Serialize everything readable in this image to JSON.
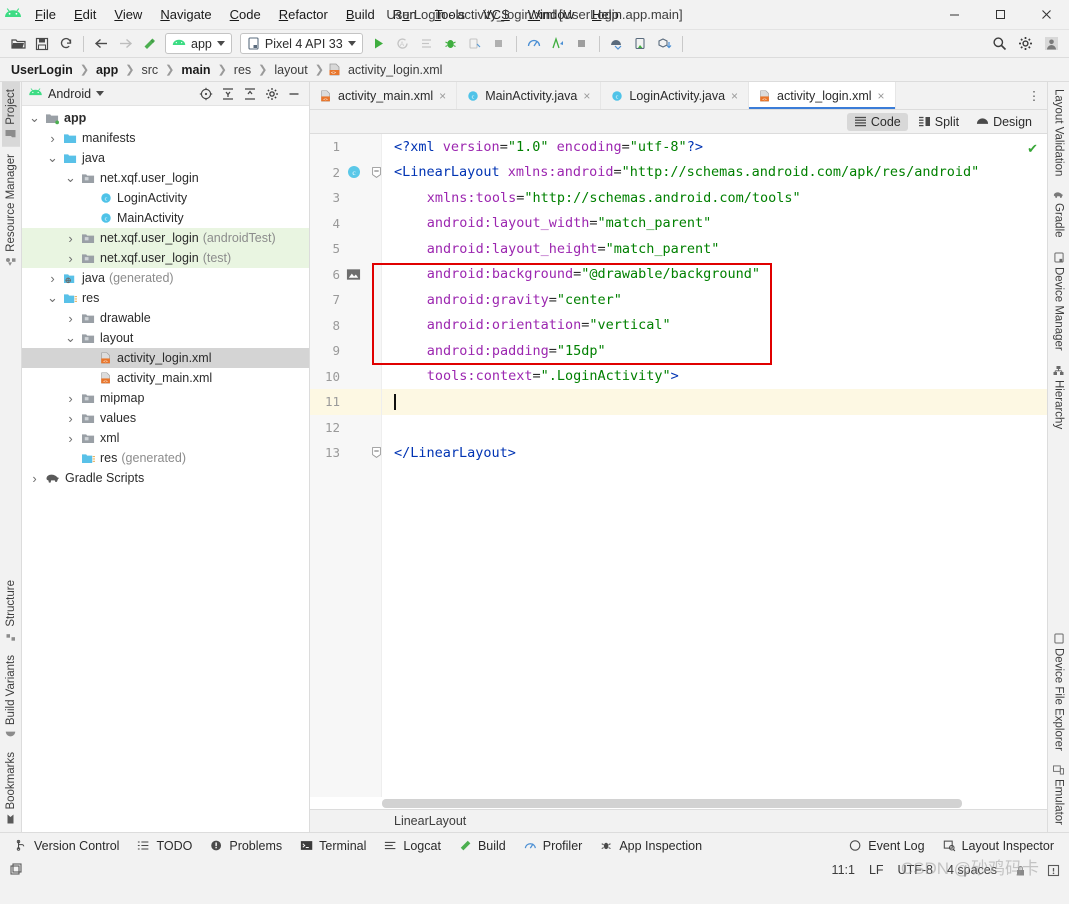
{
  "window": {
    "title": "UserLogin - activity_login.xml [UserLogin.app.main]",
    "minimize": "—",
    "maximize": "☐",
    "close": "✕"
  },
  "menu": [
    {
      "label": "File",
      "mnemonic": "F"
    },
    {
      "label": "Edit",
      "mnemonic": "E"
    },
    {
      "label": "View",
      "mnemonic": "V"
    },
    {
      "label": "Navigate",
      "mnemonic": "N"
    },
    {
      "label": "Code",
      "mnemonic": "C"
    },
    {
      "label": "Refactor",
      "mnemonic": "R"
    },
    {
      "label": "Build",
      "mnemonic": "B"
    },
    {
      "label": "Run",
      "mnemonic": "u"
    },
    {
      "label": "Tools",
      "mnemonic": "T"
    },
    {
      "label": "VCS",
      "mnemonic": "S"
    },
    {
      "label": "Window",
      "mnemonic": "W"
    },
    {
      "label": "Help",
      "mnemonic": "H"
    }
  ],
  "toolbar": {
    "icons_left": [
      "open-folder-icon",
      "save-icon",
      "sync-icon"
    ],
    "nav_icons": [
      "back-arrow-icon",
      "forward-arrow-icon",
      "build-hammer-icon"
    ],
    "module_combo": "app",
    "device_combo": "Pixel 4 API 33",
    "run_icons": [
      "run-icon",
      "apply-changes-icon",
      "apply-code-changes-icon",
      "debug-icon",
      "attach-debugger-icon",
      "stop-icon"
    ],
    "right_icons": [
      "profiler-icon",
      "profile-run-icon",
      "stop-square-icon",
      "device-mirror-icon",
      "device-explorer-icon",
      "sdk-download-icon"
    ],
    "far_right_icons": [
      "search-icon",
      "gear-icon",
      "avatar-icon"
    ]
  },
  "breadcrumb": [
    {
      "label": "UserLogin",
      "bold": true
    },
    {
      "label": "app",
      "bold": true
    },
    {
      "label": "src",
      "bold": false
    },
    {
      "label": "main",
      "bold": true
    },
    {
      "label": "res",
      "bold": false
    },
    {
      "label": "layout",
      "bold": false
    },
    {
      "label": "activity_login.xml",
      "bold": false,
      "icon": "xml-file-icon"
    }
  ],
  "left_strip": {
    "top": [
      {
        "label": "Project",
        "icon": "project-icon",
        "active": true
      },
      {
        "label": "Resource Manager",
        "icon": "resource-manager-icon",
        "active": false
      }
    ],
    "bottom": [
      {
        "label": "Structure",
        "icon": "structure-icon"
      },
      {
        "label": "Build Variants",
        "icon": "build-variants-icon"
      },
      {
        "label": "Bookmarks",
        "icon": "bookmarks-icon"
      }
    ]
  },
  "right_strip": {
    "top": [
      {
        "label": "Layout Validation",
        "icon": "layout-validation-icon"
      },
      {
        "label": "Gradle",
        "icon": "gradle-elephant-icon"
      },
      {
        "label": "Device Manager",
        "icon": "device-manager-icon"
      },
      {
        "label": "Hierarchy",
        "icon": "hierarchy-icon"
      }
    ],
    "bottom": [
      {
        "label": "Device File Explorer",
        "icon": "device-file-explorer-icon"
      },
      {
        "label": "Emulator",
        "icon": "emulator-icon"
      }
    ]
  },
  "project_panel": {
    "title": "Android",
    "header_icons": [
      "select-opened-file-icon",
      "expand-all-icon",
      "collapse-all-icon",
      "settings-gear-icon",
      "hide-icon"
    ],
    "tree": [
      {
        "label": "app",
        "indent": 0,
        "arrow": "down",
        "icon": "module-folder-icon",
        "bold": true,
        "state": "normal"
      },
      {
        "label": "manifests",
        "indent": 1,
        "arrow": "right",
        "icon": "folder-icon",
        "bold": false,
        "state": "normal"
      },
      {
        "label": "java",
        "indent": 1,
        "arrow": "down",
        "icon": "folder-icon",
        "bold": false,
        "state": "normal"
      },
      {
        "label": "net.xqf.user_login",
        "indent": 2,
        "arrow": "down",
        "icon": "package-icon",
        "bold": false,
        "state": "normal"
      },
      {
        "label": "LoginActivity",
        "indent": 3,
        "arrow": "none",
        "icon": "java-class-icon",
        "bold": false,
        "state": "normal"
      },
      {
        "label": "MainActivity",
        "indent": 3,
        "arrow": "none",
        "icon": "java-class-icon",
        "bold": false,
        "state": "normal"
      },
      {
        "label": "net.xqf.user_login",
        "suffix": "(androidTest)",
        "indent": 2,
        "arrow": "right",
        "icon": "package-icon",
        "bold": false,
        "state": "green"
      },
      {
        "label": "net.xqf.user_login",
        "suffix": "(test)",
        "indent": 2,
        "arrow": "right",
        "icon": "package-icon",
        "bold": false,
        "state": "green"
      },
      {
        "label": "java",
        "suffix": "(generated)",
        "indent": 1,
        "arrow": "right",
        "icon": "generated-folder-icon",
        "bold": false,
        "state": "normal"
      },
      {
        "label": "res",
        "indent": 1,
        "arrow": "down",
        "icon": "res-folder-icon",
        "bold": false,
        "state": "normal"
      },
      {
        "label": "drawable",
        "indent": 2,
        "arrow": "right",
        "icon": "package-icon",
        "bold": false,
        "state": "normal"
      },
      {
        "label": "layout",
        "indent": 2,
        "arrow": "down",
        "icon": "package-icon",
        "bold": false,
        "state": "normal"
      },
      {
        "label": "activity_login.xml",
        "indent": 3,
        "arrow": "none",
        "icon": "xml-file-icon",
        "bold": false,
        "state": "selected"
      },
      {
        "label": "activity_main.xml",
        "indent": 3,
        "arrow": "none",
        "icon": "xml-file-icon",
        "bold": false,
        "state": "normal"
      },
      {
        "label": "mipmap",
        "indent": 2,
        "arrow": "right",
        "icon": "package-icon",
        "bold": false,
        "state": "normal"
      },
      {
        "label": "values",
        "indent": 2,
        "arrow": "right",
        "icon": "package-icon",
        "bold": false,
        "state": "normal"
      },
      {
        "label": "xml",
        "indent": 2,
        "arrow": "right",
        "icon": "package-icon",
        "bold": false,
        "state": "normal"
      },
      {
        "label": "res",
        "suffix": "(generated)",
        "indent": 2,
        "arrow": "none",
        "icon": "res-folder-icon",
        "bold": false,
        "state": "normal"
      },
      {
        "label": "Gradle Scripts",
        "indent": 0,
        "arrow": "right",
        "icon": "gradle-elephant-icon",
        "bold": false,
        "state": "normal"
      }
    ]
  },
  "editor": {
    "tabs": [
      {
        "label": "activity_main.xml",
        "icon": "xml-file-icon",
        "active": false
      },
      {
        "label": "MainActivity.java",
        "icon": "java-class-icon",
        "active": false
      },
      {
        "label": "LoginActivity.java",
        "icon": "java-class-icon",
        "active": false
      },
      {
        "label": "activity_login.xml",
        "icon": "xml-file-icon",
        "active": true
      }
    ],
    "tab_close": "×",
    "more_tabs": "⋮",
    "modes": [
      {
        "label": "Code",
        "icon": "code-view-icon",
        "active": true
      },
      {
        "label": "Split",
        "icon": "split-view-icon",
        "active": false
      },
      {
        "label": "Design",
        "icon": "design-view-icon",
        "active": false
      }
    ],
    "inspection_ok": "✔",
    "bottom_breadcrumb": "LinearLayout",
    "code_lines": [
      {
        "n": 1,
        "segments": [
          {
            "t": "<?xml ",
            "c": "tok-br"
          },
          {
            "t": "version",
            "c": "tok-attr"
          },
          {
            "t": "=",
            "c": "tok-eq"
          },
          {
            "t": "\"1.0\"",
            "c": "tok-val"
          },
          {
            "t": " ",
            "c": "tok-eq"
          },
          {
            "t": "encoding",
            "c": "tok-attr"
          },
          {
            "t": "=",
            "c": "tok-eq"
          },
          {
            "t": "\"utf-8\"",
            "c": "tok-val"
          },
          {
            "t": "?>",
            "c": "tok-br"
          }
        ]
      },
      {
        "n": 2,
        "gutter_icon": "class-marker-icon",
        "fold": true,
        "segments": [
          {
            "t": "<LinearLayout ",
            "c": "tok-tag"
          },
          {
            "t": "xmlns:android",
            "c": "tok-attr"
          },
          {
            "t": "=",
            "c": "tok-eq"
          },
          {
            "t": "\"http://schemas.android.com/apk/res/android\"",
            "c": "tok-val"
          }
        ]
      },
      {
        "n": 3,
        "indent": 4,
        "segments": [
          {
            "t": "xmlns:tools",
            "c": "tok-attr"
          },
          {
            "t": "=",
            "c": "tok-eq"
          },
          {
            "t": "\"http://schemas.android.com/tools\"",
            "c": "tok-val"
          }
        ]
      },
      {
        "n": 4,
        "indent": 4,
        "segments": [
          {
            "t": "android:layout_width",
            "c": "tok-attr"
          },
          {
            "t": "=",
            "c": "tok-eq"
          },
          {
            "t": "\"match_parent\"",
            "c": "tok-val"
          }
        ]
      },
      {
        "n": 5,
        "indent": 4,
        "segments": [
          {
            "t": "android:layout_height",
            "c": "tok-attr"
          },
          {
            "t": "=",
            "c": "tok-eq"
          },
          {
            "t": "\"match_parent\"",
            "c": "tok-val"
          }
        ]
      },
      {
        "n": 6,
        "indent": 4,
        "gutter_icon": "image-preview-icon",
        "segments": [
          {
            "t": "android:background",
            "c": "tok-attr"
          },
          {
            "t": "=",
            "c": "tok-eq"
          },
          {
            "t": "\"@drawable/background\"",
            "c": "tok-val"
          }
        ]
      },
      {
        "n": 7,
        "indent": 4,
        "segments": [
          {
            "t": "android:gravity",
            "c": "tok-attr"
          },
          {
            "t": "=",
            "c": "tok-eq"
          },
          {
            "t": "\"center\"",
            "c": "tok-val"
          }
        ]
      },
      {
        "n": 8,
        "indent": 4,
        "segments": [
          {
            "t": "android:orientation",
            "c": "tok-attr"
          },
          {
            "t": "=",
            "c": "tok-eq"
          },
          {
            "t": "\"vertical\"",
            "c": "tok-val"
          }
        ]
      },
      {
        "n": 9,
        "indent": 4,
        "segments": [
          {
            "t": "android:padding",
            "c": "tok-attr"
          },
          {
            "t": "=",
            "c": "tok-eq"
          },
          {
            "t": "\"15dp\"",
            "c": "tok-val"
          }
        ]
      },
      {
        "n": 10,
        "indent": 4,
        "segments": [
          {
            "t": "tools:context",
            "c": "tok-attr"
          },
          {
            "t": "=",
            "c": "tok-eq"
          },
          {
            "t": "\".LoginActivity\"",
            "c": "tok-val"
          },
          {
            "t": ">",
            "c": "tok-br"
          }
        ]
      },
      {
        "n": 11,
        "current": true,
        "caret": true,
        "segments": []
      },
      {
        "n": 12,
        "segments": []
      },
      {
        "n": 13,
        "fold": true,
        "segments": [
          {
            "t": "</LinearLayout>",
            "c": "tok-tag"
          }
        ]
      }
    ],
    "annotation": {
      "color": "#e00000",
      "covers_lines": "6-9"
    }
  },
  "tool_windows": [
    {
      "label": "Version Control",
      "icon": "branch-icon"
    },
    {
      "label": "TODO",
      "icon": "todo-list-icon"
    },
    {
      "label": "Problems",
      "icon": "problems-icon"
    },
    {
      "label": "Terminal",
      "icon": "terminal-icon"
    },
    {
      "label": "Logcat",
      "icon": "logcat-icon"
    },
    {
      "label": "Build",
      "icon": "build-hammer-icon"
    },
    {
      "label": "Profiler",
      "icon": "profiler-icon"
    },
    {
      "label": "App Inspection",
      "icon": "app-inspection-icon"
    }
  ],
  "tool_windows_right": [
    {
      "label": "Event Log",
      "icon": "event-log-icon"
    },
    {
      "label": "Layout Inspector",
      "icon": "layout-inspector-icon"
    }
  ],
  "status_bar": {
    "layout_icon": "layout-toggle-icon",
    "caret_position": "11:1",
    "line_separator": "LF",
    "encoding": "UTF-8",
    "indent": "4 spaces",
    "lock_icon": "read-only-lock-icon",
    "notification_icon": "notification-icon",
    "watermark": "CSDN @砂鸡码卡"
  },
  "colors": {
    "accent": "#3b7dd8",
    "annotation_red": "#e00000",
    "android_green": "#3ddc84",
    "attr_purple": "#9c27b0",
    "value_green": "#008000",
    "tag_blue": "#0033b3",
    "selected_row": "#d4d4d4",
    "test_row_green": "#e9f5e1",
    "caret_line": "#fdf8e3"
  }
}
